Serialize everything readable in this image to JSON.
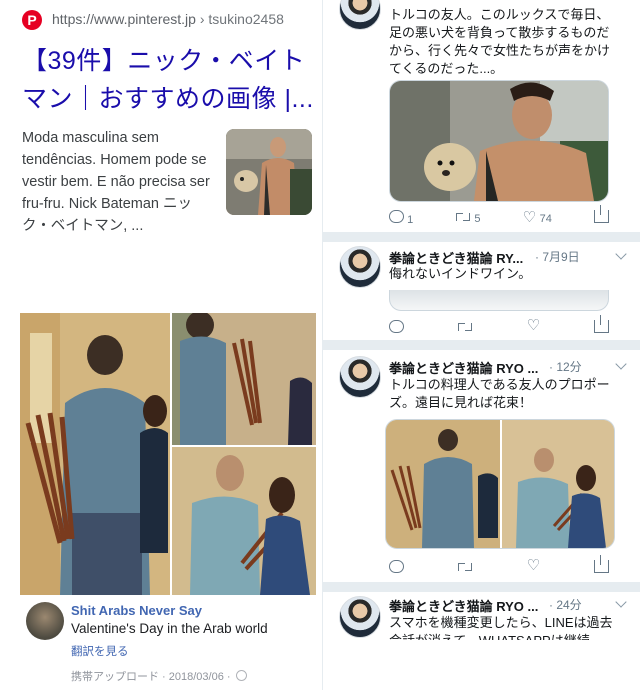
{
  "pinterest": {
    "logo": "P",
    "url": "https://www.pinterest.jp",
    "user": "› tsukino2458",
    "title": "【39件】ニック・ベイトマン｜おすすめの画像 |...",
    "snippet": "Moda masculina sem tendências. Homem pode se vestir bem. E não precisa ser fru-fru. Nick Bateman ニック・ベイトマン, ..."
  },
  "facebook": {
    "author": "Shit Arabs Never Say",
    "text": "Valentine's Day in the Arab world",
    "translate": "翻訳を見る",
    "meta": "携帯アップロード · 2018/03/06 ·"
  },
  "twitter": {
    "tweet1": {
      "text": "トルコの友人。このルックスで毎日、足の悪い犬を背負って散歩するものだから、行く先々で女性たちが声をかけてくるのだった...。",
      "reply": "1",
      "retweet": "5",
      "like": "74"
    },
    "tweet2": {
      "name": "拳論ときどき猫論 RY...",
      "time": "· 7月9日",
      "text": "侮れないインドワイン。"
    },
    "tweet3": {
      "name": "拳論ときどき猫論 RYO ...",
      "time": "· 12分",
      "text": "トルコの料理人である友人のプロポーズ。遠目に見れば花束！"
    },
    "tweet4": {
      "name": "拳論ときどき猫論 RYO ...",
      "time": "· 24分",
      "text": "スマホを機種変更したら、LINEは過去会話が消えて、WHATSAPPは継続"
    }
  },
  "colors": {
    "link_blue": "#1a0dab",
    "facebook_blue": "#4267b2",
    "pinterest_red": "#e60023",
    "twitter_gray": "#657786"
  }
}
